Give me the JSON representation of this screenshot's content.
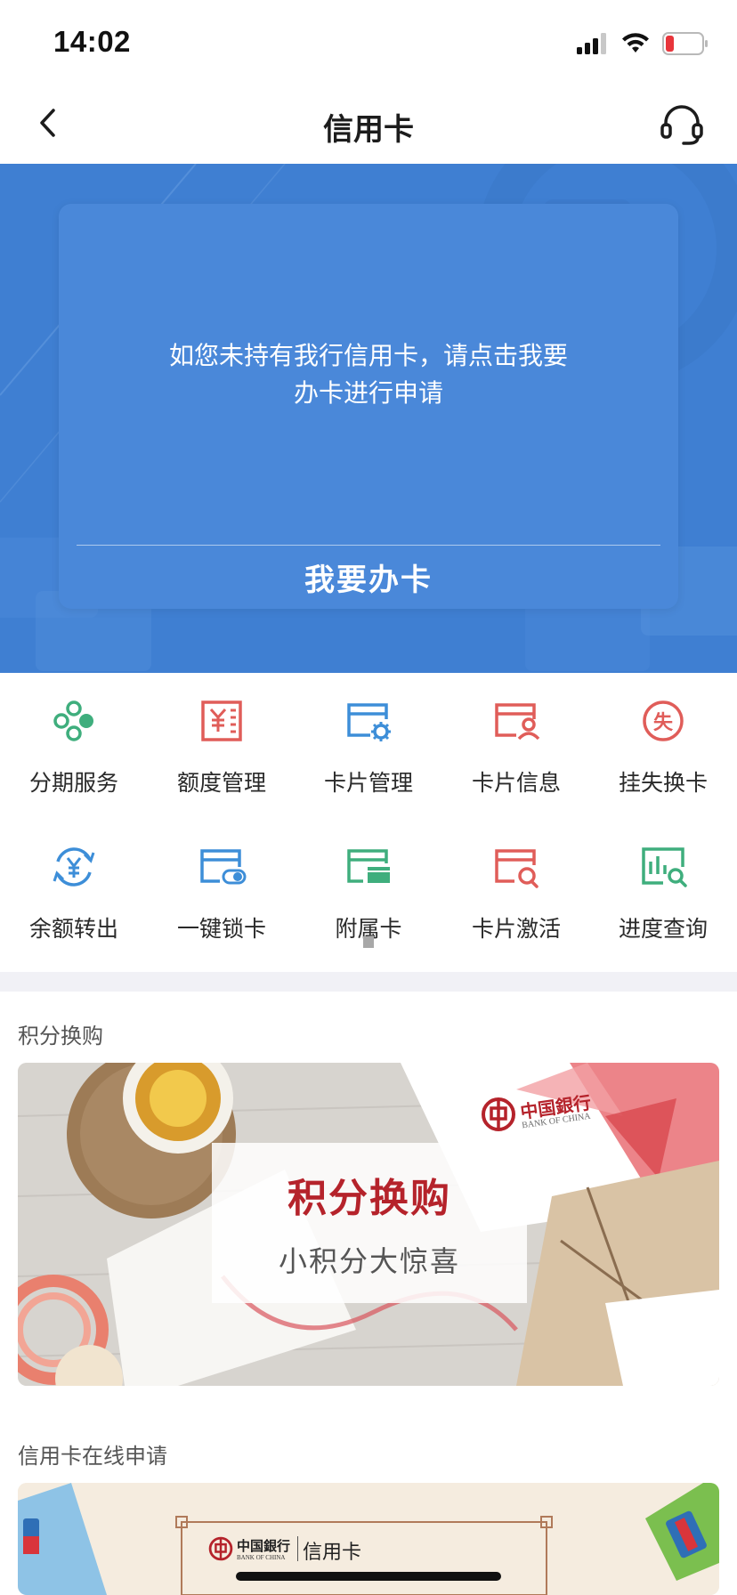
{
  "status_bar": {
    "time": "14:02"
  },
  "nav": {
    "title": "信用卡"
  },
  "hero": {
    "message": "如您未持有我行信用卡，请点击我要办卡进行申请",
    "message_line1": "如您未持有我行信用卡，请点击我要",
    "message_line2": "办卡进行申请",
    "apply_label": "我要办卡"
  },
  "grid": {
    "items": [
      {
        "label": "分期服务",
        "icon": "installment-icon",
        "color": "#3fae7d"
      },
      {
        "label": "额度管理",
        "icon": "limit-icon",
        "color": "#e05d59"
      },
      {
        "label": "卡片管理",
        "icon": "card-settings-icon",
        "color": "#3d8ed8"
      },
      {
        "label": "卡片信息",
        "icon": "card-info-icon",
        "color": "#e05d59"
      },
      {
        "label": "挂失换卡",
        "icon": "report-loss-icon",
        "color": "#e05d59"
      },
      {
        "label": "余额转出",
        "icon": "balance-transfer-icon",
        "color": "#3d8ed8"
      },
      {
        "label": "一键锁卡",
        "icon": "card-lock-icon",
        "color": "#3d8ed8"
      },
      {
        "label": "附属卡",
        "icon": "supplementary-card-icon",
        "color": "#3fae7d"
      },
      {
        "label": "卡片激活",
        "icon": "card-activate-icon",
        "color": "#e05d59"
      },
      {
        "label": "进度查询",
        "icon": "progress-query-icon",
        "color": "#3fae7d"
      }
    ]
  },
  "points_section": {
    "title": "积分换购",
    "banner_title": "积分换购",
    "banner_subtitle": "小积分大惊喜",
    "logo_text": "中国銀行",
    "logo_en": "BANK OF CHINA"
  },
  "apply_section": {
    "title": "信用卡在线申请",
    "logo_text": "中国銀行",
    "logo_en": "BANK OF CHINA",
    "banner_label": "信用卡"
  },
  "colors": {
    "hero_bg": "#3f7fd2",
    "accent_red": "#b5232b",
    "green": "#3fae7d",
    "blue": "#3d8ed8",
    "red": "#e05d59"
  }
}
